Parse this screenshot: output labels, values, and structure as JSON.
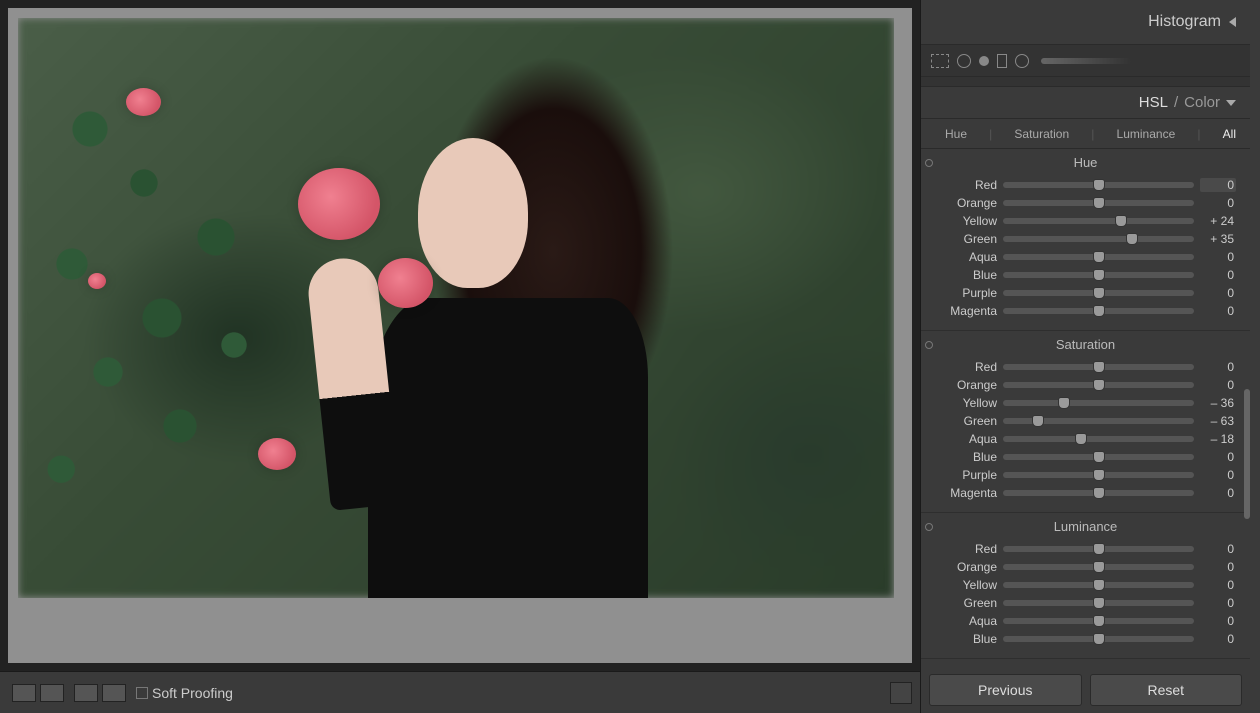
{
  "histogram": {
    "title": "Histogram"
  },
  "hsl_panel": {
    "title_left": "HSL",
    "title_sep": " / ",
    "title_right": "Color",
    "tabs": {
      "hue": "Hue",
      "saturation": "Saturation",
      "luminance": "Luminance",
      "all": "All"
    },
    "active_tab": "All"
  },
  "colors": [
    "Red",
    "Orange",
    "Yellow",
    "Green",
    "Aqua",
    "Blue",
    "Purple",
    "Magenta"
  ],
  "hue": {
    "title": "Hue",
    "Red": 0,
    "Orange": 0,
    "Yellow": 24,
    "Green": 35,
    "Aqua": 0,
    "Blue": 0,
    "Purple": 0,
    "Magenta": 0
  },
  "saturation": {
    "title": "Saturation",
    "Red": 0,
    "Orange": 0,
    "Yellow": -36,
    "Green": -63,
    "Aqua": -18,
    "Blue": 0,
    "Purple": 0,
    "Magenta": 0
  },
  "luminance": {
    "title": "Luminance",
    "Red": 0,
    "Orange": 0,
    "Yellow": 0,
    "Green": 0,
    "Aqua": 0,
    "Blue": 0
  },
  "buttons": {
    "previous": "Previous",
    "reset": "Reset"
  },
  "bottom_bar": {
    "soft_proofing": "Soft Proofing"
  }
}
